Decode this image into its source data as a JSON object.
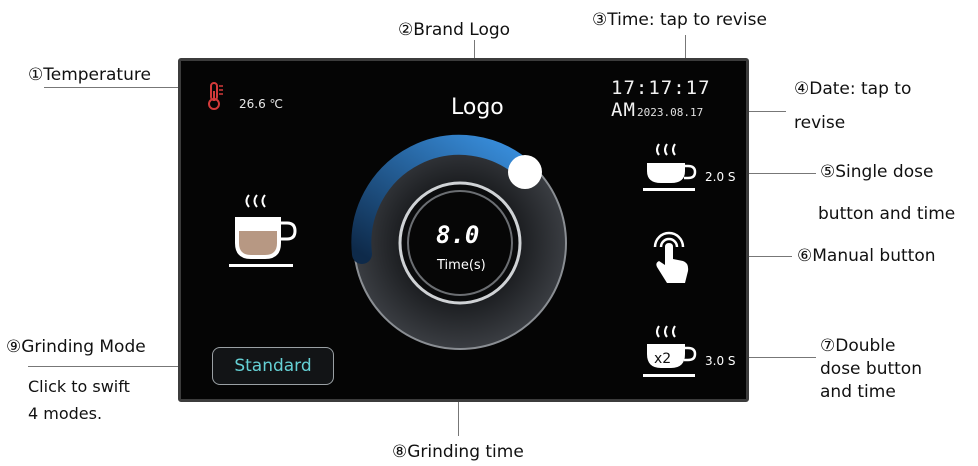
{
  "annotations": {
    "temperature": "①Temperature",
    "brand_logo": "②Brand Logo",
    "time": "③Time: tap to revise",
    "date_line1": "④Date: tap to",
    "date_line2": "revise",
    "single_line1": "⑤Single dose",
    "single_line2": "button and time",
    "manual": "⑥Manual button",
    "double_line1": "⑦Double",
    "double_line2": "dose button",
    "double_line3": "and time",
    "grinding_time": "⑧Grinding time",
    "mode_line1": "⑨Grinding Mode",
    "mode_line2": "Click to swift",
    "mode_line3": "4 modes."
  },
  "screen": {
    "temperature": "26.6 ℃",
    "logo": "Logo",
    "time": "17:17:17 AM",
    "date": "2023.08.17",
    "single_dose_time": "2.0 S",
    "double_dose_time": "3.0 S",
    "double_badge": "x2",
    "dial_value": "8.0",
    "dial_unit": "Time(s)",
    "mode": "Standard"
  },
  "colors": {
    "screen_bg": "#050505",
    "mode_text": "#65d0d4",
    "dial_arc": "#2d7fd0",
    "thermo": "#d33a3a",
    "coffee": "#b79883"
  },
  "icons": [
    "thermometer-icon",
    "coffee-cup-icon",
    "single-dose-cup-icon",
    "manual-touch-icon",
    "double-dose-cup-icon"
  ]
}
